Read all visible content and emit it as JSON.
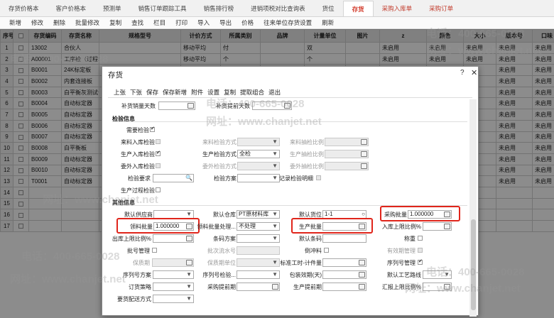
{
  "tabs": [
    "存货价格本",
    "客户价格本",
    "预测单",
    "销售订单跟踪工具",
    "销售排行榜",
    "进销项税对比查询表",
    "货位",
    "存货",
    "采购入库单",
    "采购订单"
  ],
  "toolbar": [
    "新增",
    "修改",
    "删除",
    "批量修改",
    "复制",
    "查找",
    "栏目",
    "打印",
    "导入",
    "导出",
    "价格",
    "往来单位存货设置",
    "刷新"
  ],
  "columns": [
    "序号",
    "",
    "存货编码",
    "存货名称",
    "规格型号",
    "计价方式",
    "所属类别",
    "品牌",
    "计量单位",
    "图片",
    "z",
    "颜色",
    "大小",
    "版本号",
    "口味"
  ],
  "rows": [
    [
      "1",
      "13002",
      "合伙人",
      "",
      "移动平均",
      "付",
      "",
      "双",
      "",
      "未启用",
      "未启用",
      "未启用",
      "未启用",
      "未启用"
    ],
    [
      "2",
      "A00001",
      "工序检（过程...",
      "",
      "移动平均",
      "个",
      "",
      "个",
      "",
      "未启用",
      "未启用",
      "未启用",
      "未启用",
      "未启用"
    ],
    [
      "3",
      "B0001",
      "24K标定板",
      "",
      "",
      "",
      "",
      "",
      "",
      "",
      "",
      "",
      "未启用",
      "未启用"
    ],
    [
      "4",
      "B0002",
      "内套连接板",
      "",
      "",
      "",
      "",
      "",
      "",
      "",
      "",
      "",
      "未启用",
      "未启用"
    ],
    [
      "5",
      "B0003",
      "白平衡灰测试卡",
      "",
      "",
      "",
      "",
      "",
      "",
      "",
      "",
      "",
      "未启用",
      "未启用"
    ],
    [
      "6",
      "B0004",
      "自动标定器",
      "",
      "",
      "",
      "",
      "",
      "",
      "",
      "",
      "",
      "未启用",
      "未启用"
    ],
    [
      "7",
      "B0005",
      "自动标定器",
      "",
      "",
      "",
      "",
      "",
      "",
      "",
      "",
      "",
      "未启用",
      "未启用"
    ],
    [
      "8",
      "B0006",
      "自动标定器",
      "",
      "",
      "",
      "",
      "",
      "",
      "",
      "",
      "",
      "未启用",
      "未启用"
    ],
    [
      "9",
      "B0007",
      "自动标定器",
      "",
      "",
      "",
      "",
      "",
      "",
      "",
      "",
      "",
      "未启用",
      "未启用"
    ],
    [
      "10",
      "B0008",
      "白平衡板",
      "",
      "",
      "",
      "",
      "",
      "",
      "",
      "",
      "",
      "未启用",
      "未启用"
    ],
    [
      "11",
      "B0009",
      "自动标定器",
      "",
      "",
      "",
      "",
      "",
      "",
      "",
      "",
      "",
      "未启用",
      "未启用"
    ],
    [
      "12",
      "B0010",
      "自动标定器",
      "",
      "",
      "",
      "",
      "",
      "",
      "",
      "",
      "",
      "未启用",
      "未启用"
    ],
    [
      "13",
      "T0001",
      "自动标定器",
      "",
      "",
      "",
      "",
      "",
      "",
      "",
      "",
      "",
      "未启用",
      "未启用"
    ],
    [
      "14",
      "",
      "",
      "",
      "",
      "",
      "",
      "",
      "",
      "",
      "",
      "",
      "",
      ""
    ],
    [
      "15",
      "",
      "",
      "",
      "",
      "",
      "",
      "",
      "",
      "",
      "",
      "",
      "",
      ""
    ],
    [
      "16",
      "",
      "",
      "",
      "",
      "",
      "",
      "",
      "",
      "",
      "",
      "",
      "",
      ""
    ],
    [
      "17",
      "",
      "",
      "",
      "",
      "",
      "",
      "",
      "",
      "",
      "",
      "",
      "",
      ""
    ]
  ],
  "dialog": {
    "title": "存货",
    "help": "?",
    "close": "✕",
    "menu": [
      "上张",
      "下张",
      "保存",
      "保存新增",
      "附件",
      "设置",
      "复制",
      "提取组合",
      "退出"
    ],
    "top": {
      "l1": "补货销量天数",
      "l2": "补货提前天数"
    },
    "sec1": "检验信息",
    "need_check": "需要检验",
    "incoming_check": "来料入库检验",
    "incoming_method": "来料检验方式",
    "incoming_ratio": "来料抽检比例",
    "prod_check": "生产入库检验",
    "prod_method": "生产检验方式",
    "prod_method_val": "全检",
    "prod_ratio": "生产抽检比例",
    "outsource_check": "委外入库检验",
    "outsource_method": "委外检验方式",
    "outsource_ratio": "委外抽检比例",
    "req": "检验要求",
    "plan": "检验方案",
    "record": "记录检验明细",
    "process_check": "生产过程检验",
    "sec2": "其他信息",
    "supplier": "默认供应商",
    "warehouse": "默认仓库",
    "warehouse_val": "PT原材料库",
    "location": "默认货位",
    "location_val": "1-1",
    "purchase_batch": "采购批量",
    "purchase_batch_val": "1.000000",
    "material_batch": "领料批量",
    "material_batch_val": "1.000000",
    "material_handling": "领料批量处理...",
    "material_handling_val": "不处理",
    "prod_batch": "生产批量",
    "in_upper": "入库上限比例%",
    "out_upper": "出库上限比例%",
    "bom": "条码方案",
    "default_barcode": "默认条码",
    "weighable": "称重",
    "batch_mgmt": "批号管理",
    "serial": "批次流水号",
    "reserve": "倒冲料",
    "valid_mgmt": "有效期管理",
    "shelf": "保质期",
    "shelf_unit": "保质期单位",
    "std_hours": "标准工时-计件量",
    "serial_mgmt": "序列号管理",
    "serial_plan": "序列号方案",
    "serial_verify": "序列号检验...",
    "pack_capacity": "包装效期(天)",
    "default_route": "默认工艺路线",
    "order_strategy": "订货策略",
    "purchase_lead": "采购提前期",
    "prod_lead": "生产提前期",
    "report_upper": "汇报上限比例%",
    "delivery": "要货配送方式"
  },
  "watermarks": [
    "电话：400-665-0028",
    "网址：www.chanjet.net"
  ]
}
